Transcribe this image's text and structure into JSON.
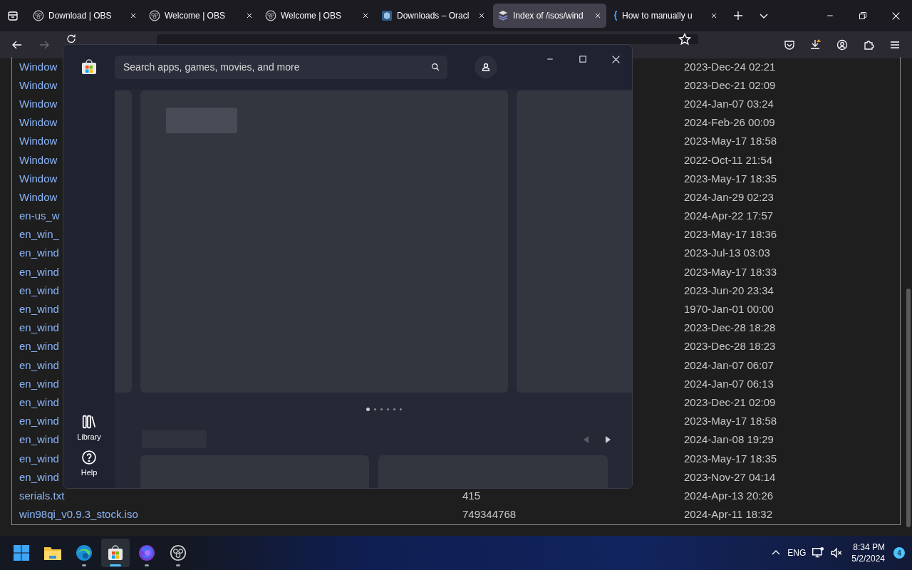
{
  "browser": {
    "tabs": [
      {
        "title": "Download | OBS",
        "kind": "obs",
        "selected": false
      },
      {
        "title": "Welcome | OBS",
        "kind": "obs",
        "selected": false
      },
      {
        "title": "Welcome | OBS",
        "kind": "obs",
        "selected": false
      },
      {
        "title": "Downloads – Oracl",
        "kind": "vbox",
        "selected": false
      },
      {
        "title": "Index of /isos/wind",
        "kind": "page",
        "selected": true
      },
      {
        "title": "How to manually u",
        "kind": "brace",
        "selected": false
      }
    ],
    "address_visible": true
  },
  "listing": {
    "rows": [
      {
        "name": "Window",
        "date": "2023-Dec-24 02:21"
      },
      {
        "name": "Window",
        "date": "2023-Dec-21 02:09"
      },
      {
        "name": "Window",
        "date": "2024-Jan-07 03:24"
      },
      {
        "name": "Window",
        "date": "2024-Feb-26 00:09"
      },
      {
        "name": "Window",
        "date": "2023-May-17 18:58"
      },
      {
        "name": "Window",
        "date": "2022-Oct-11 21:54"
      },
      {
        "name": "Window",
        "date": "2023-May-17 18:35"
      },
      {
        "name": "Window",
        "date": "2024-Jan-29 02:23"
      },
      {
        "name": "en-us_w",
        "date": "2024-Apr-22 17:57"
      },
      {
        "name": "en_win_",
        "date": "2023-May-17 18:36"
      },
      {
        "name": "en_wind",
        "date": "2023-Jul-13 03:03"
      },
      {
        "name": "en_wind",
        "date": "2023-May-17 18:33"
      },
      {
        "name": "en_wind",
        "date": "2023-Jun-20 23:34"
      },
      {
        "name": "en_wind",
        "date": "1970-Jan-01 00:00"
      },
      {
        "name": "en_wind",
        "date": "2023-Dec-28 18:28"
      },
      {
        "name": "en_wind",
        "date": "2023-Dec-28 18:23"
      },
      {
        "name": "en_wind",
        "date": "2024-Jan-07 06:07"
      },
      {
        "name": "en_wind",
        "date": "2024-Jan-07 06:13"
      },
      {
        "name": "en_wind",
        "date": "2023-Dec-21 02:09"
      },
      {
        "name": "en_wind",
        "date": "2023-May-17 18:58"
      },
      {
        "name": "en_wind",
        "date": "2024-Jan-08 19:29"
      },
      {
        "name": "en_wind",
        "date": "2023-May-17 18:35"
      },
      {
        "name": "en_wind",
        "date": "2023-Nov-27 04:14"
      },
      {
        "name": "serials.txt",
        "size": "415",
        "date": "2024-Apr-13 20:26"
      },
      {
        "name": "win98qi_v0.9.3_stock.iso",
        "size": "749344768",
        "date": "2024-Apr-11 18:32"
      }
    ]
  },
  "store": {
    "search": {
      "placeholder": "Search apps, games, movies, and more"
    },
    "rail": [
      {
        "label": "Library",
        "kind": "library"
      },
      {
        "label": "Help",
        "kind": "help"
      }
    ],
    "carousel_dots": [
      {
        "selected": true
      },
      {
        "selected": false
      },
      {
        "selected": false
      },
      {
        "selected": false
      },
      {
        "selected": false
      },
      {
        "selected": false
      }
    ],
    "row_nav": [
      {
        "kind": "prev",
        "disabled": true
      },
      {
        "kind": "next",
        "disabled": false
      }
    ]
  },
  "taskbar": {
    "apps": [
      {
        "kind": "start",
        "running": false,
        "selected": false
      },
      {
        "kind": "folder",
        "running": false,
        "selected": false
      },
      {
        "kind": "edge",
        "running": true,
        "selected": false
      },
      {
        "kind": "store",
        "running": true,
        "selected": true
      },
      {
        "kind": "firefox",
        "running": true,
        "selected": false
      },
      {
        "kind": "obs",
        "running": true,
        "selected": false
      }
    ],
    "tray": {
      "language": "ENG",
      "time": "8:34 PM",
      "date": "5/2/2024",
      "notifications": "4"
    }
  }
}
